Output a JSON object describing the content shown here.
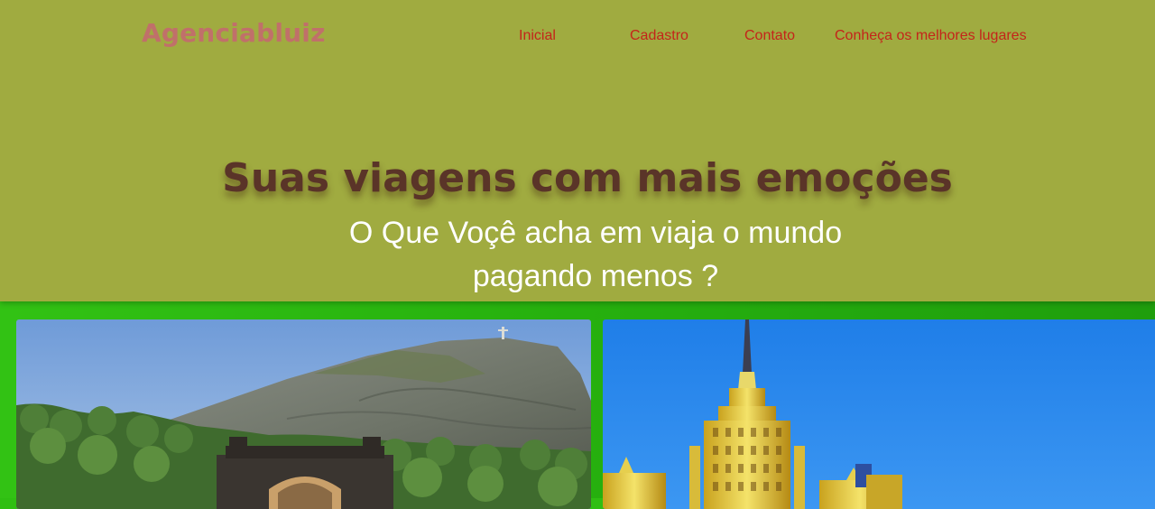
{
  "header": {
    "logo": "Agenciabluiz",
    "nav": [
      {
        "label": "Inicial"
      },
      {
        "label": "Cadastro"
      },
      {
        "label": "Contato"
      },
      {
        "label": "Conheça os melhores lugares"
      }
    ]
  },
  "hero": {
    "title": "Suas viagens com mais emoções",
    "subtitle": "O Que Voçê acha em viaja o mundo pagando menos ?"
  },
  "colors": {
    "hero_bg": "#a0ab40",
    "page_bg": "#2fbf12",
    "logo": "#c0706a",
    "nav_link": "#c4241a",
    "title": "#5a3428",
    "subtitle": "#ffffff"
  },
  "gallery": {
    "photos": [
      {
        "icon": "rio-mountain-photo"
      },
      {
        "icon": "moscow-tower-photo"
      }
    ]
  }
}
